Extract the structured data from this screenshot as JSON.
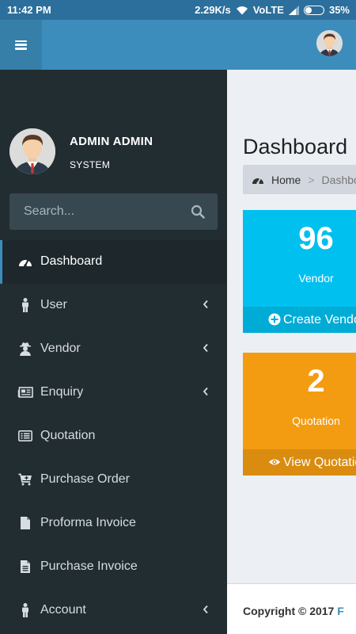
{
  "status_bar": {
    "time": "11:42 PM",
    "speed": "2.29K/s",
    "network": "VoLTE",
    "battery": "35%",
    "battery_level": 0.35
  },
  "header": {
    "menu_icon": "hamburger-icon",
    "avatar": "user-avatar"
  },
  "sidebar": {
    "user": {
      "name": "ADMIN ADMIN",
      "role": "SYSTEM"
    },
    "search": {
      "placeholder": "Search...",
      "value": ""
    },
    "items": [
      {
        "label": "Dashboard",
        "icon": "dashboard-icon",
        "active": true,
        "has_submenu": false
      },
      {
        "label": "User",
        "icon": "male-icon",
        "active": false,
        "has_submenu": true
      },
      {
        "label": "Vendor",
        "icon": "user-secret-icon",
        "active": false,
        "has_submenu": true
      },
      {
        "label": "Enquiry",
        "icon": "newspaper-icon",
        "active": false,
        "has_submenu": true
      },
      {
        "label": "Quotation",
        "icon": "list-alt-icon",
        "active": false,
        "has_submenu": false
      },
      {
        "label": "Purchase Order",
        "icon": "cart-plus-icon",
        "active": false,
        "has_submenu": false
      },
      {
        "label": "Proforma Invoice",
        "icon": "file-icon",
        "active": false,
        "has_submenu": false
      },
      {
        "label": "Purchase Invoice",
        "icon": "file-text-icon",
        "active": false,
        "has_submenu": false
      },
      {
        "label": "Account",
        "icon": "male-icon",
        "active": false,
        "has_submenu": true
      }
    ]
  },
  "main": {
    "title": "Dashboard",
    "breadcrumb": {
      "home": "Home",
      "separator": ">",
      "current": "Dashboard"
    },
    "boxes": [
      {
        "value": "96",
        "label": "Vendor",
        "footer": "Create Vendor",
        "footer_icon": "plus-circle-icon",
        "color": "#00c0ef"
      },
      {
        "value": "2",
        "label": "Quotation",
        "footer": "View Quotation",
        "footer_icon": "eye-icon",
        "color": "#f39c12"
      }
    ],
    "footer": {
      "copyright": "Copyright © 2017",
      "link": "F"
    }
  },
  "colors": {
    "header": "#3c8dbc",
    "sidebar": "#222d32",
    "active_accent": "#3c8dbc"
  }
}
